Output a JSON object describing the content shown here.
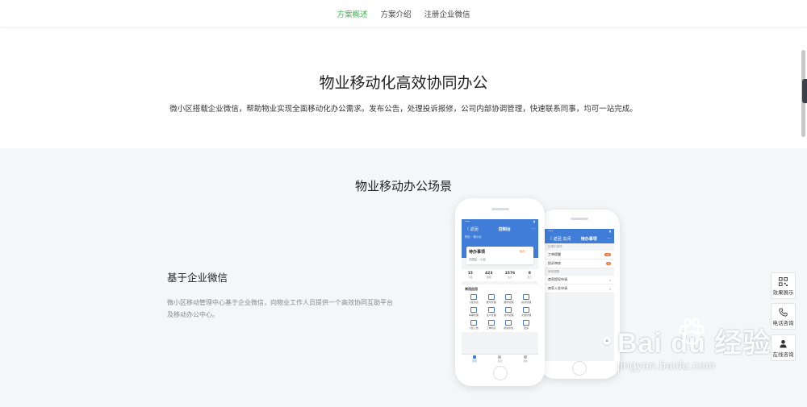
{
  "nav": {
    "items": [
      {
        "label": "方案概述",
        "active": true
      },
      {
        "label": "方案介绍",
        "active": false
      },
      {
        "label": "注册企业微信",
        "active": false
      }
    ],
    "active_color": "#3bb34a"
  },
  "hero": {
    "title": "物业移动化高效协同办公",
    "subtitle": "微小区搭载企业微信，帮助物业实现全面移动化办公需求。发布公告，处理投诉报修，公司内部协调管理，快速联系同事，均可一站完成。"
  },
  "scene": {
    "title": "物业移动办公场景",
    "feature_title": "基于企业微信",
    "feature_desc": "微小区移动管理中心基于企业微信，向物业工作人员提供一个高效协同互助平台及移动办公中心。"
  },
  "phone_front": {
    "back": "〈 返回",
    "title": "控制台",
    "crumbs": "物业 · 微小区",
    "todo_title": "待办事项",
    "todo_sub": "花园区 › 小区",
    "todo_tag": "待办 ›",
    "stats": [
      {
        "value": "15",
        "label": "小区"
      },
      {
        "value": "423",
        "label": "楼栋"
      },
      {
        "value": "1576",
        "label": "住户"
      },
      {
        "value": "8",
        "label": "员工"
      }
    ],
    "apps_title": "常用应用",
    "apps": [
      "小区列表",
      "楼宇管理",
      "报修管理",
      "投诉管理",
      "车辆管理",
      "住户管理",
      "访问管理",
      "文章管理",
      "小区公告",
      "工单列表",
      "模块列表",
      "更多"
    ],
    "tabs": [
      "首页",
      "消息",
      "我的"
    ]
  },
  "phone_back": {
    "back": "〈 返回",
    "close": "关闭",
    "title": "待办事项",
    "section1": "处理中事项",
    "rows1": [
      {
        "label": "工单提醒",
        "badge": "12"
      },
      {
        "label": "投诉审核",
        "badge": "5"
      }
    ],
    "section2": "审核提醒",
    "rows2": [
      "商家提现申请",
      "商家入驻申请"
    ]
  },
  "float_panel": {
    "items": [
      {
        "label": "效果展示",
        "icon": "qr-code-icon"
      },
      {
        "label": "电话咨询",
        "icon": "phone-icon"
      },
      {
        "label": "在线咨询",
        "icon": "user-icon"
      }
    ]
  },
  "watermark": {
    "brand": "Bai du 经验",
    "url": "jingyan.baidu.com"
  }
}
